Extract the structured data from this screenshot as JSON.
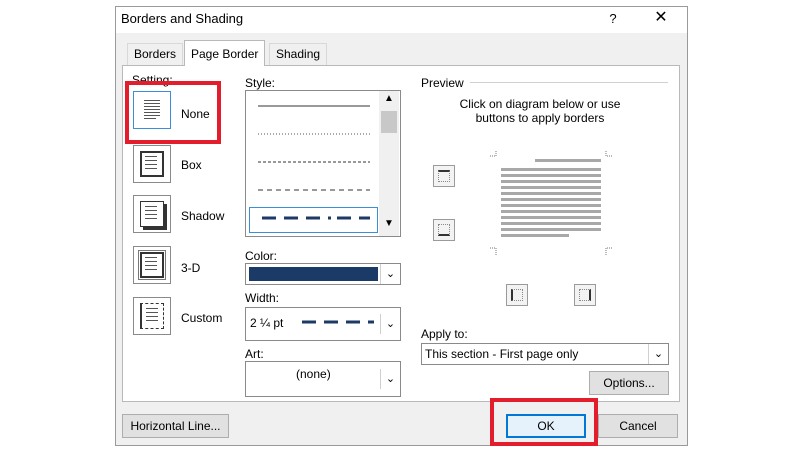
{
  "window": {
    "title": "Borders and Shading",
    "help": "?",
    "close": "✕"
  },
  "tabs": [
    {
      "label": "Borders"
    },
    {
      "label": "Page Border"
    },
    {
      "label": "Shading"
    }
  ],
  "setting": {
    "label": "Setting:",
    "items": [
      {
        "label": "None"
      },
      {
        "label": "Box"
      },
      {
        "label": "Shadow"
      },
      {
        "label": "3-D"
      },
      {
        "label": "Custom"
      }
    ]
  },
  "style": {
    "label": "Style:",
    "selected_index": 4
  },
  "color": {
    "label": "Color:",
    "value_hex": "#1b3a66"
  },
  "width": {
    "label": "Width:",
    "value": "2 ¼ pt"
  },
  "art": {
    "label": "Art:",
    "value": "(none)"
  },
  "preview": {
    "label": "Preview",
    "hint": "Click on diagram below or use buttons to apply borders"
  },
  "apply_to": {
    "label": "Apply to:",
    "value": "This section - First page only"
  },
  "buttons": {
    "options": "Options...",
    "horizontal_line": "Horizontal Line...",
    "ok": "OK",
    "cancel": "Cancel"
  },
  "colors": {
    "highlight": "#e31d2c",
    "accent": "#0078d7"
  }
}
